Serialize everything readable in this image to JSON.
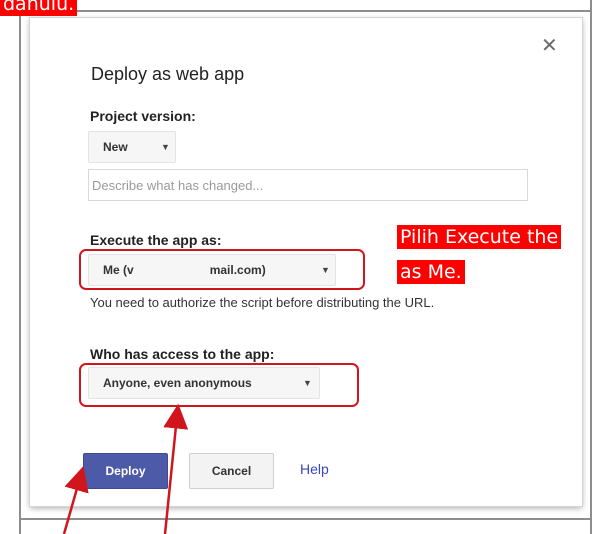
{
  "annotations": {
    "top_label": "dahulu.",
    "side_label_line1": "Pilih Execute the",
    "side_label_line2": "as Me.",
    "color": "#ff0000"
  },
  "dialog": {
    "title": "Deploy as web app",
    "close_icon": "close-icon",
    "project_version": {
      "label": "Project version:",
      "selected": "New",
      "description_placeholder": "Describe what has changed..."
    },
    "execute_as": {
      "label": "Execute the app as:",
      "selected_prefix": "Me (v",
      "selected_suffix": "mail.com)",
      "note": "You need to authorize the script before distributing the URL."
    },
    "access": {
      "label": "Who has access to the app:",
      "selected": "Anyone, even anonymous"
    },
    "buttons": {
      "deploy": "Deploy",
      "cancel": "Cancel",
      "help": "Help"
    }
  },
  "colors": {
    "deploy_button": "#4d5aa8",
    "help_link": "#3a45c0",
    "annotation_box": "#d0161c"
  }
}
